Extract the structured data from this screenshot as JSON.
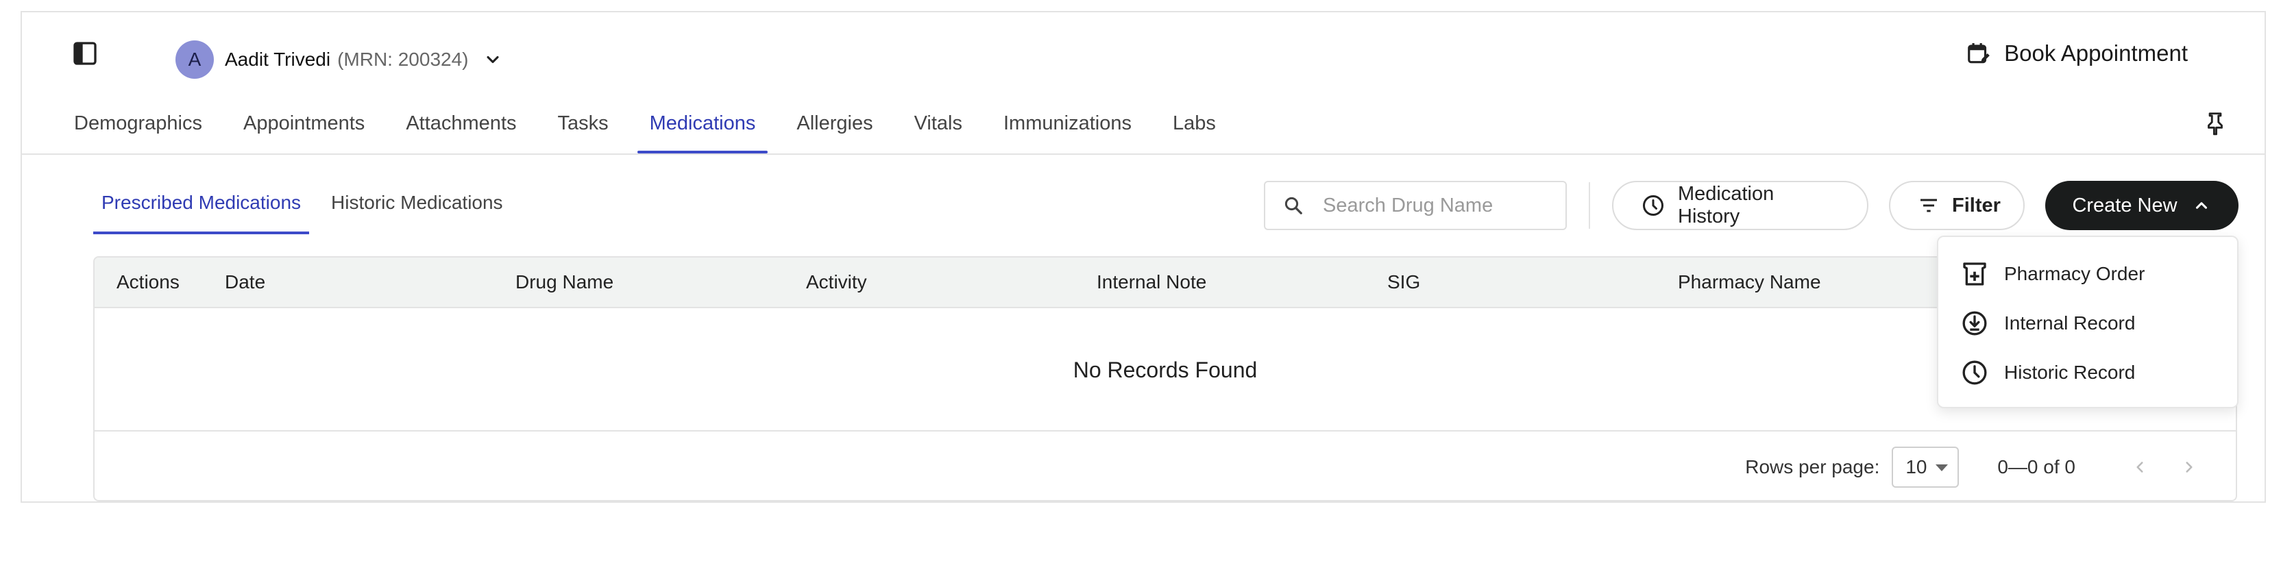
{
  "patient": {
    "avatar_letter": "A",
    "name": "Aadit Trivedi",
    "mrn": "(MRN: 200324)"
  },
  "header": {
    "book_label": "Book Appointment"
  },
  "tabs": [
    {
      "label": "Demographics"
    },
    {
      "label": "Appointments"
    },
    {
      "label": "Attachments"
    },
    {
      "label": "Tasks"
    },
    {
      "label": "Medications",
      "active": true
    },
    {
      "label": "Allergies"
    },
    {
      "label": "Vitals"
    },
    {
      "label": "Immunizations"
    },
    {
      "label": "Labs"
    }
  ],
  "subtabs": [
    {
      "label": "Prescribed Medications",
      "active": true
    },
    {
      "label": "Historic Medications"
    }
  ],
  "toolbar": {
    "search_placeholder": "Search Drug Name",
    "history_label": "Medication History",
    "filter_label": "Filter",
    "create_label": "Create New"
  },
  "table": {
    "columns": [
      "Actions",
      "Date",
      "Drug Name",
      "Activity",
      "Internal Note",
      "SIG",
      "Pharmacy Name"
    ],
    "empty_text": "No Records Found",
    "rows_per_page_label": "Rows per page:",
    "rows_per_page_value": "10",
    "range_text": "0—0 of 0"
  },
  "create_menu": {
    "items": [
      {
        "label": "Pharmacy Order",
        "icon": "pharmacy-icon"
      },
      {
        "label": "Internal Record",
        "icon": "download-circle-icon"
      },
      {
        "label": "Historic Record",
        "icon": "clock-icon"
      }
    ]
  },
  "colors": {
    "accent": "#3d4bc9",
    "primary_button": "#1a1c1c",
    "avatar": "#8a8fd6"
  }
}
